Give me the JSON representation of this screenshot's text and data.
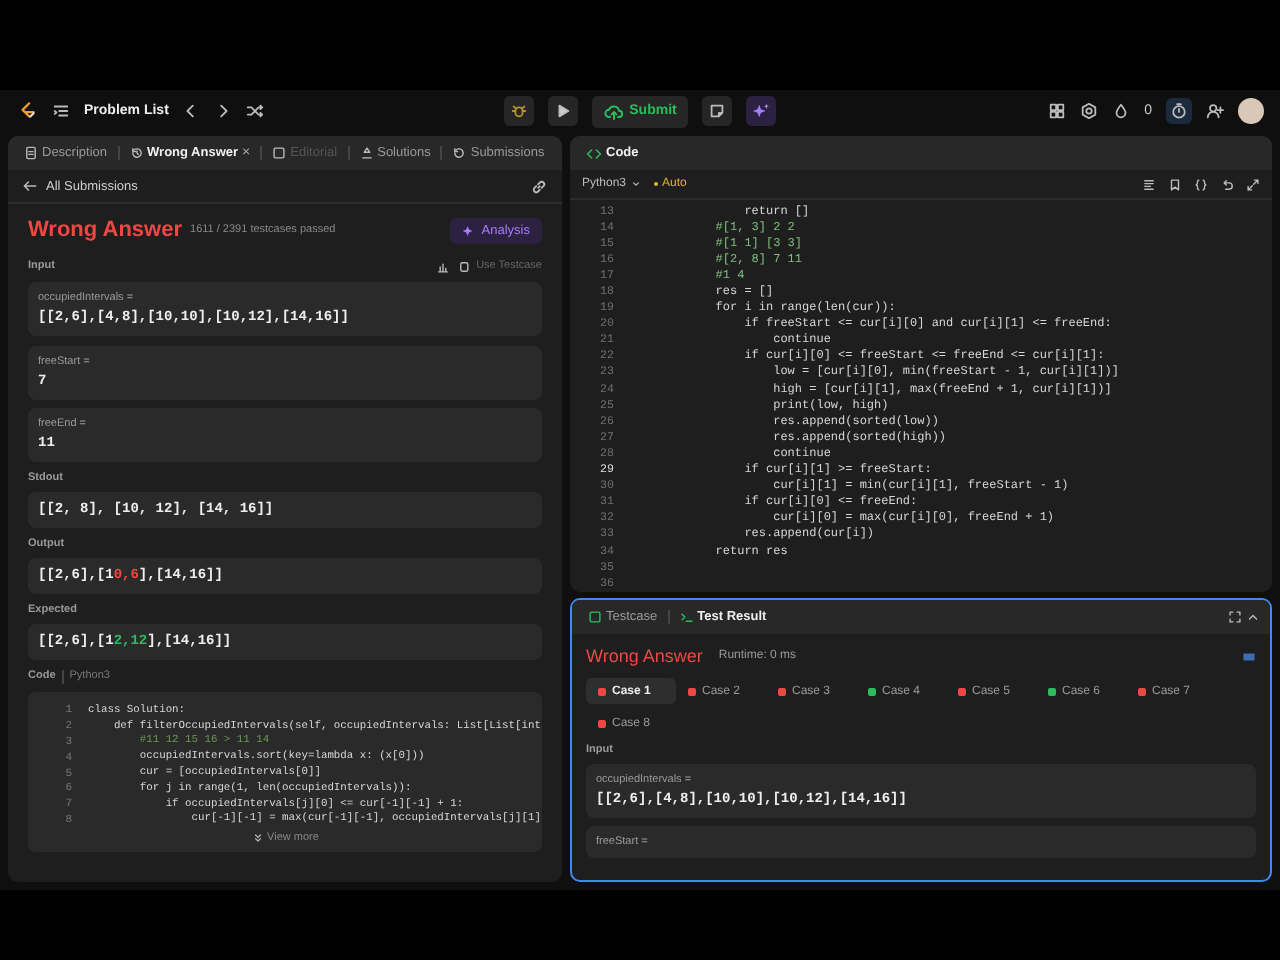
{
  "topbar": {
    "problem_list": "Problem List",
    "submit": "Submit",
    "streak": "0"
  },
  "left_tabs": [
    {
      "label": "Description",
      "selected": false,
      "disabled": false
    },
    {
      "label": "Wrong Answer",
      "selected": true,
      "disabled": false,
      "close": "×"
    },
    {
      "label": "Editorial",
      "selected": false,
      "disabled": true
    },
    {
      "label": "Solutions",
      "selected": false,
      "disabled": false
    },
    {
      "label": "Submissions",
      "selected": false,
      "disabled": false
    }
  ],
  "back_link": "All Submissions",
  "result": {
    "status": "Wrong Answer",
    "passed": "1611 / 2391 testcases passed",
    "analysis": "Analysis",
    "input_label": "Input",
    "use_testcase": "Use Testcase",
    "inputs": [
      {
        "name": "occupiedIntervals =",
        "value": "[[2,6],[4,8],[10,10],[10,12],[14,16]]"
      },
      {
        "name": "freeStart =",
        "value": "7"
      },
      {
        "name": "freeEnd =",
        "value": "11"
      }
    ],
    "stdout_label": "Stdout",
    "stdout": "[[2, 8], [10, 12], [14, 16]]",
    "output_label": "Output",
    "output": [
      {
        "text": "[[2,6],[1",
        "kind": "same"
      },
      {
        "text": "0,6",
        "kind": "wrong"
      },
      {
        "text": "],[14,16]]",
        "kind": "same"
      }
    ],
    "expected_label": "Expected",
    "expected": [
      {
        "text": "[[2,6],[1",
        "kind": "same"
      },
      {
        "text": "2,12",
        "kind": "correct"
      },
      {
        "text": "],[14,16]]",
        "kind": "same"
      }
    ],
    "code_label": "Code",
    "code_lang": "Python3",
    "code_lines": [
      {
        "no": "1",
        "text": "class Solution:",
        "kind": "code"
      },
      {
        "no": "2",
        "text": "    def filterOccupiedIntervals(self, occupiedIntervals: List[List[int",
        "kind": "code"
      },
      {
        "no": "3",
        "text": "        #11 12 15 16 > 11 14",
        "kind": "comment"
      },
      {
        "no": "4",
        "text": "        occupiedIntervals.sort(key=lambda x: (x[0]))",
        "kind": "code"
      },
      {
        "no": "5",
        "text": "        cur = [occupiedIntervals[0]]",
        "kind": "code"
      },
      {
        "no": "6",
        "text": "        for j in range(1, len(occupiedIntervals)):",
        "kind": "code"
      },
      {
        "no": "7",
        "text": "            if occupiedIntervals[j][0] <= cur[-1][-1] + 1:",
        "kind": "code"
      },
      {
        "no": "8",
        "text": "                cur[-1][-1] = max(cur[-1][-1], occupiedIntervals[j][1]",
        "kind": "code"
      }
    ],
    "view_more": "View more"
  },
  "code_panel": {
    "title": "Code",
    "language": "Python3",
    "mode": "Auto",
    "lines": [
      {
        "no": "13",
        "text": "            return []",
        "kind": "code",
        "active": false
      },
      {
        "no": "14",
        "text": "        #[1, 3] 2 2",
        "kind": "comment",
        "active": false
      },
      {
        "no": "15",
        "text": "        #[1 1] [3 3]",
        "kind": "comment",
        "active": false
      },
      {
        "no": "16",
        "text": "        #[2, 8] 7 11",
        "kind": "comment",
        "active": false
      },
      {
        "no": "17",
        "text": "        #1 4",
        "kind": "comment",
        "active": false
      },
      {
        "no": "18",
        "text": "        res = []",
        "kind": "code",
        "active": false
      },
      {
        "no": "19",
        "text": "        for i in range(len(cur)):",
        "kind": "code",
        "active": false
      },
      {
        "no": "20",
        "text": "            if freeStart <= cur[i][0] and cur[i][1] <= freeEnd:",
        "kind": "code",
        "active": false
      },
      {
        "no": "21",
        "text": "                continue",
        "kind": "code",
        "active": false
      },
      {
        "no": "22",
        "text": "            if cur[i][0] <= freeStart <= freeEnd <= cur[i][1]:",
        "kind": "code",
        "active": false
      },
      {
        "no": "23",
        "text": "                low = [cur[i][0], min(freeStart - 1, cur[i][1])]",
        "kind": "code",
        "active": false
      },
      {
        "no": "24",
        "text": "                high = [cur[i][1], max(freeEnd + 1, cur[i][1])]",
        "kind": "code",
        "active": false
      },
      {
        "no": "25",
        "text": "                print(low, high)",
        "kind": "code",
        "active": false
      },
      {
        "no": "26",
        "text": "                res.append(sorted(low))",
        "kind": "code",
        "active": false
      },
      {
        "no": "27",
        "text": "                res.append(sorted(high))",
        "kind": "code",
        "active": false
      },
      {
        "no": "28",
        "text": "                continue",
        "kind": "code",
        "active": false
      },
      {
        "no": "29",
        "text": "            if cur[i][1] >= freeStart:",
        "kind": "code",
        "active": true
      },
      {
        "no": "30",
        "text": "                cur[i][1] = min(cur[i][1], freeStart - 1)",
        "kind": "code",
        "active": false
      },
      {
        "no": "31",
        "text": "            if cur[i][0] <= freeEnd:",
        "kind": "code",
        "active": false
      },
      {
        "no": "32",
        "text": "                cur[i][0] = max(cur[i][0], freeEnd + 1)",
        "kind": "code",
        "active": false
      },
      {
        "no": "33",
        "text": "            res.append(cur[i])",
        "kind": "code",
        "active": false
      },
      {
        "no": "34",
        "text": "        return res",
        "kind": "code",
        "active": false
      },
      {
        "no": "35",
        "active": false
      },
      {
        "no": "36",
        "active": false
      }
    ]
  },
  "test_panel": {
    "tabs": [
      {
        "label": "Testcase",
        "selected": false
      },
      {
        "label": "Test Result",
        "selected": true
      }
    ],
    "status": "Wrong Answer",
    "runtime": "Runtime: 0 ms",
    "cases": [
      {
        "label": "Case 1",
        "passed": false,
        "selected": true
      },
      {
        "label": "Case 2",
        "passed": false,
        "selected": false
      },
      {
        "label": "Case 3",
        "passed": false,
        "selected": false
      },
      {
        "label": "Case 4",
        "passed": true,
        "selected": false
      },
      {
        "label": "Case 5",
        "passed": false,
        "selected": false
      },
      {
        "label": "Case 6",
        "passed": true,
        "selected": false
      },
      {
        "label": "Case 7",
        "passed": false,
        "selected": false
      },
      {
        "label": "Case 8",
        "passed": false,
        "selected": false
      }
    ],
    "input_label": "Input",
    "inputs": [
      {
        "name": "occupiedIntervals =",
        "value": "[[2,6],[4,8],[10,10],[10,12],[14,16]]"
      },
      {
        "name": "freeStart ="
      }
    ]
  }
}
